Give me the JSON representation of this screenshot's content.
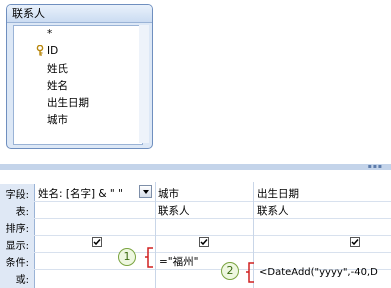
{
  "table": {
    "title": "联系人",
    "fields": [
      "*",
      "ID",
      "姓氏",
      "姓名",
      "出生日期",
      "城市"
    ]
  },
  "grid": {
    "row_labels": [
      "字段:",
      "表:",
      "排序:",
      "显示:",
      "条件:",
      "或:"
    ],
    "columns": [
      {
        "field": "姓名: [名字] & \" \"",
        "table": "",
        "show": true,
        "criteria": "=\"福州\"",
        "or": ""
      },
      {
        "field": "城市",
        "table": "联系人",
        "show": true,
        "criteria": "",
        "or": ""
      },
      {
        "field": "出生日期",
        "table": "联系人",
        "show": true,
        "criteria": "",
        "or": "<DateAdd(\"yyyy\",-40,D"
      }
    ]
  },
  "callouts": [
    "1",
    "2"
  ],
  "colors": {
    "callout_border": "#7aa440",
    "bracket": "#d02020",
    "header_bg": "#dfe8f6"
  }
}
